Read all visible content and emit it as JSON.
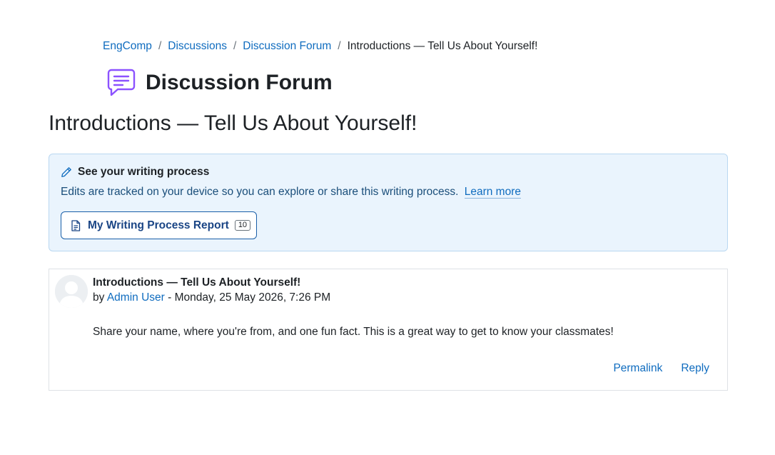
{
  "breadcrumb": {
    "items": [
      "EngComp",
      "Discussions",
      "Discussion Forum"
    ],
    "current": "Introductions — Tell Us About Yourself!",
    "separator": "/"
  },
  "activity": {
    "icon": "forum-icon",
    "name": "Discussion Forum",
    "icon_color": "#8c52ff"
  },
  "discussion": {
    "title": "Introductions — Tell Us About Yourself!"
  },
  "writing_process": {
    "icon": "pencil-icon",
    "heading": "See your writing process",
    "description": "Edits are tracked on your device so you can explore or share this writing process.",
    "learn_more": "Learn more",
    "report_button": {
      "icon": "document-icon",
      "label": "My Writing Process Report",
      "count": "10"
    }
  },
  "post": {
    "avatar_icon": "user-avatar",
    "subject": "Introductions — Tell Us About Yourself!",
    "by_prefix": "by",
    "author": "Admin User",
    "date_separator": "-",
    "date": "Monday, 25 May 2026, 7:26 PM",
    "body": "Share your name, where you're from, and one fun fact. This is a great way to get to know your classmates!",
    "actions": {
      "permalink": "Permalink",
      "reply": "Reply"
    }
  },
  "colors": {
    "link": "#0f6cbf",
    "card_background": "#eaf4fd",
    "card_border": "#b9d7f1"
  }
}
